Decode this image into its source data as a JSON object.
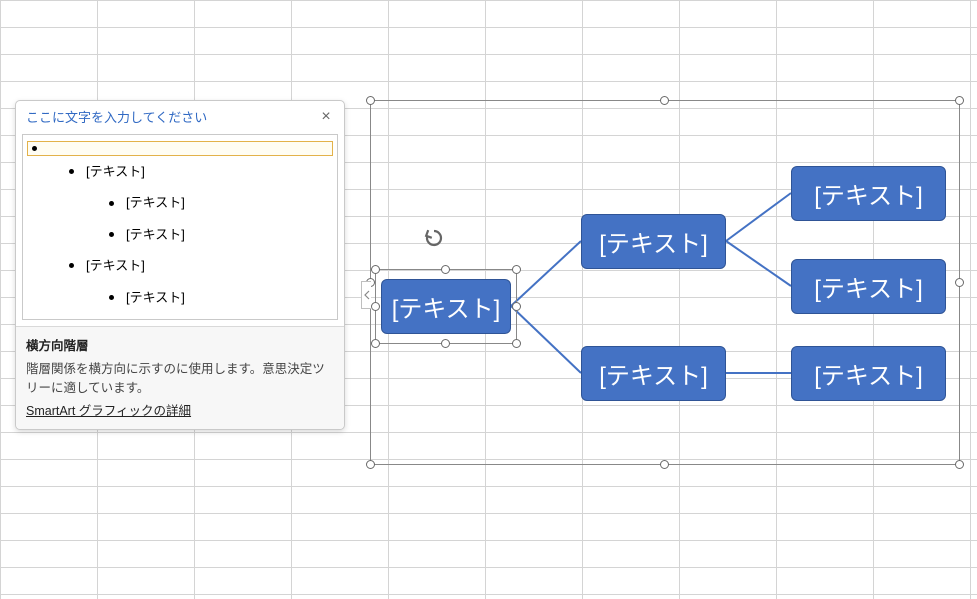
{
  "textPane": {
    "headerPrompt": "ここに文字を入力してください",
    "items": [
      {
        "text": "",
        "level": 0,
        "selected": true
      },
      {
        "text": "[テキスト]",
        "level": 1,
        "selected": false
      },
      {
        "text": "[テキスト]",
        "level": 2,
        "selected": false
      },
      {
        "text": "[テキスト]",
        "level": 2,
        "selected": false
      },
      {
        "text": "[テキスト]",
        "level": 1,
        "selected": false
      },
      {
        "text": "[テキスト]",
        "level": 2,
        "selected": false
      }
    ],
    "descTitle": "横方向階層",
    "descBody": "階層関係を横方向に示すのに使用します。意思決定ツリーに適しています。",
    "linkText": "SmartArt グラフィックの詳細"
  },
  "nodes": {
    "root": "[テキスト]",
    "child1": "[テキスト]",
    "child2": "[テキスト]",
    "leaf1": "[テキスト]",
    "leaf2": "[テキスト]",
    "leaf3": "[テキスト]"
  },
  "colors": {
    "nodeFill": "#4472c4",
    "connector": "#4472c4"
  }
}
